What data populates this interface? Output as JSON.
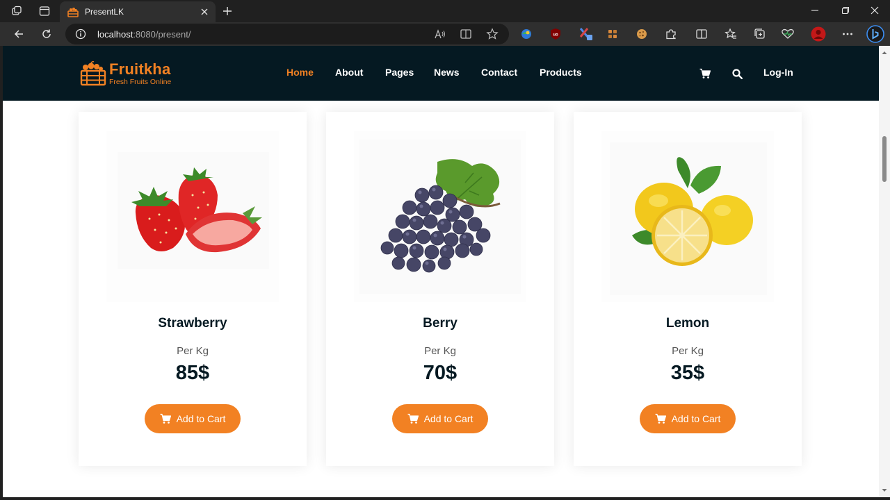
{
  "browser": {
    "tab_title": "PresentLK",
    "url_host": "localhost",
    "url_rest": ":8080/present/"
  },
  "site": {
    "logo_name": "Fruitkha",
    "logo_tagline": "Fresh Fruits Online",
    "nav": [
      "Home",
      "About",
      "Pages",
      "News",
      "Contact",
      "Products"
    ],
    "active_nav": "Home",
    "login_label": "Log-In",
    "accent_color": "#F28123",
    "header_color": "#051922"
  },
  "products": [
    {
      "name": "Strawberry",
      "unit": "Per Kg",
      "price": "85$",
      "button": "Add to Cart",
      "image": "strawberry"
    },
    {
      "name": "Berry",
      "unit": "Per Kg",
      "price": "70$",
      "button": "Add to Cart",
      "image": "grapes"
    },
    {
      "name": "Lemon",
      "unit": "Per Kg",
      "price": "35$",
      "button": "Add to Cart",
      "image": "lemon"
    }
  ]
}
